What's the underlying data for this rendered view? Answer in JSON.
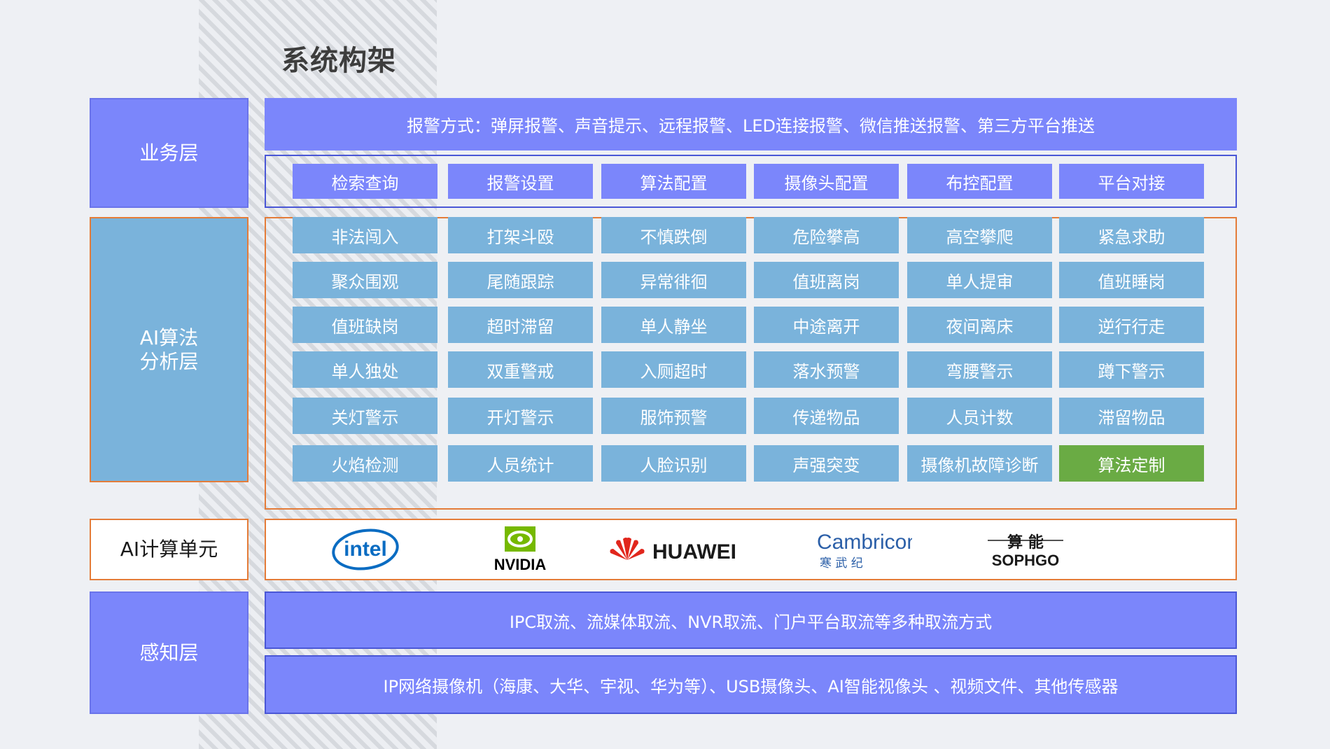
{
  "title": "系统构架",
  "layers": {
    "business": "业务层",
    "ai_analysis": "AI算法\n分析层",
    "compute": "AI计算单元",
    "perception": "感知层"
  },
  "alarm_bar": "报警方式：弹屏报警、声音提示、远程报警、LED连接报警、微信推送报警、第三方平台推送",
  "business_functions": [
    "检索查询",
    "报警设置",
    "算法配置",
    "摄像头配置",
    "布控配置",
    "平台对接"
  ],
  "algorithms": [
    [
      "非法闯入",
      "打架斗殴",
      "不慎跌倒",
      "危险攀高",
      "高空攀爬",
      "紧急求助"
    ],
    [
      "聚众围观",
      "尾随跟踪",
      "异常徘徊",
      "值班离岗",
      "单人提审",
      "值班睡岗"
    ],
    [
      "值班缺岗",
      "超时滞留",
      "单人静坐",
      "中途离开",
      "夜间离床",
      "逆行行走"
    ],
    [
      "单人独处",
      "双重警戒",
      "入厕超时",
      "落水预警",
      "弯腰警示",
      "蹲下警示"
    ],
    [
      "关灯警示",
      "开灯警示",
      "服饰预警",
      "传递物品",
      "人员计数",
      "滞留物品"
    ],
    [
      "火焰检测",
      "人员统计",
      "人脸识别",
      "声强突变",
      "摄像机故障诊断",
      "算法定制"
    ]
  ],
  "compute_logos": {
    "intel": "intel",
    "nvidia": "NVIDIA",
    "huawei": "HUAWEI",
    "cambricon": "Cambricon",
    "cambricon_cn": "寒  武  纪",
    "sophgo_cn": "算 能",
    "sophgo": "SOPHGO"
  },
  "perception_bars": [
    "IPC取流、流媒体取流、NVR取流、门户平台取流等多种取流方式",
    "IP网络摄像机（海康、大华、宇视、华为等）、USB摄像头、AI智能视像头 、视频文件、其他传感器"
  ],
  "colors": {
    "purple": "#7b86fb",
    "blue": "#7ab3db",
    "green": "#6aab44",
    "orange_border": "#e47c39"
  }
}
